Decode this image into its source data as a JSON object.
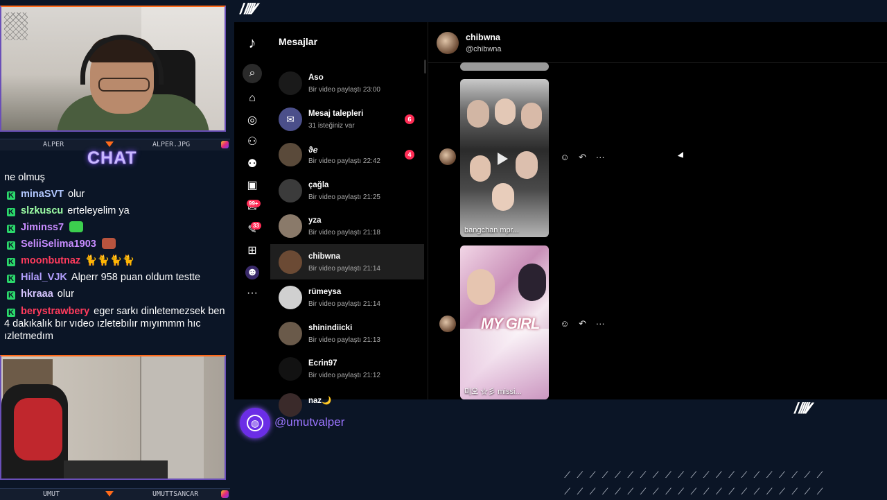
{
  "stream": {
    "cam_top_name_left": "ALPER",
    "cam_top_name_right": "ALPER.JPG",
    "cam_bottom_name_left": "UMUT",
    "cam_bottom_name_right": "UMUTTSANCAR",
    "chat_title": "CHAT",
    "chat": [
      {
        "user": "",
        "text": "ne olmuş",
        "badge": false,
        "color": "#ffffff"
      },
      {
        "user": "minaSVT",
        "text": "olur",
        "badge": true,
        "color": "#b3c8ff"
      },
      {
        "user": "slzkuscu",
        "text": "erteleyelim ya",
        "badge": true,
        "color": "#9dffa6"
      },
      {
        "user": "Jiminss7",
        "text": "",
        "badge": true,
        "color": "#c88cff",
        "emote": "#3ccf4e"
      },
      {
        "user": "SeliiSelima1903",
        "text": "",
        "badge": true,
        "color": "#c88cff",
        "emote": "#b9543e"
      },
      {
        "user": "moonbutnaz",
        "text": "🐈🐈🐈🐈",
        "badge": true,
        "color": "#ff3b5c"
      },
      {
        "user": "Hilal_VJK",
        "text": "Alperr 958 puan oldum testte",
        "badge": true,
        "color": "#b3a0ff"
      },
      {
        "user": "hkraaa",
        "text": "olur",
        "badge": true,
        "color": "#d7c6ff"
      },
      {
        "user": "berystrawbery",
        "text": "eger sarkı dinletemezsek ben 4 dakıkalık bır vıdeo ızletebılır mıyımmm hıc ızletmedım",
        "badge": true,
        "color": "#ff3b5c",
        "multi": true
      }
    ],
    "social_handle": "@umutvalper"
  },
  "app": {
    "rail": {
      "logo_icon": "tiktok-logo",
      "badge_notifications": "99+",
      "badge_messages": "33",
      "more": "···"
    },
    "messages_header": "Mesajlar",
    "conversations": [
      {
        "name": "Aso",
        "sub": "Bir video paylaştı 23:00",
        "count": "",
        "active": false,
        "avatar": "#1a1a1a"
      },
      {
        "name": "Mesaj talepleri",
        "sub": "31 isteğiniz var",
        "count": "6",
        "active": false,
        "avatar": "#4b4f8a"
      },
      {
        "name": "ϑℯ",
        "sub": "Bir video paylaştı 22:42",
        "count": "4",
        "active": false,
        "avatar": "#5a4a3a"
      },
      {
        "name": "çağla",
        "sub": "Bir video paylaştı 21:25",
        "count": "",
        "active": false,
        "avatar": "#3b3b3b"
      },
      {
        "name": "yza",
        "sub": "Bir video paylaştı 21:18",
        "count": "",
        "active": false,
        "avatar": "#8a7a6a"
      },
      {
        "name": "chibwna",
        "sub": "Bir video paylaştı 21:14",
        "count": "",
        "active": true,
        "avatar": "#6b4a34"
      },
      {
        "name": "rümeysa",
        "sub": "Bir video paylaştı 21:14",
        "count": "",
        "active": false,
        "avatar": "#d0d0d0"
      },
      {
        "name": "shinindiicki",
        "sub": "Bir video paylaştı 21:13",
        "count": "",
        "active": false,
        "avatar": "#6a5a4a"
      },
      {
        "name": "Ecrin97",
        "sub": "Bir video paylaştı 21:12",
        "count": "",
        "active": false,
        "avatar": "#121212"
      },
      {
        "name": "naz🌙",
        "sub": "",
        "count": "",
        "active": false,
        "avatar": "#3a2a2a"
      }
    ],
    "thread": {
      "name": "chibwna",
      "handle": "@chibwna",
      "videos": [
        {
          "caption": "bangchan mpr...",
          "overlay": ""
        },
        {
          "caption": "미오 ☆彡 missi...",
          "overlay": "MY GIRL"
        }
      ],
      "actions": {
        "react": "☺",
        "reply": "↶",
        "more": "···"
      }
    }
  }
}
